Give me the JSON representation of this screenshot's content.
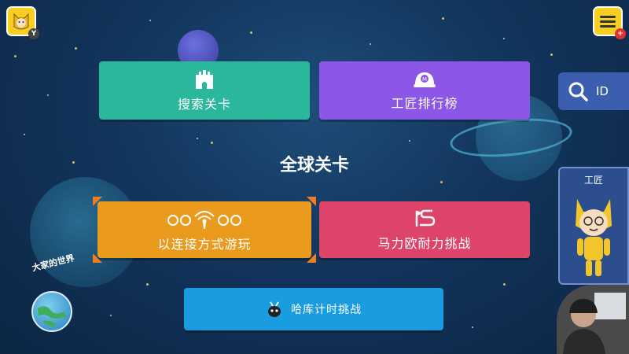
{
  "top_bar": {
    "profile_badge": "Y",
    "menu_badge": "+"
  },
  "buttons": {
    "search_levels": "搜索关卡",
    "maker_ranking": "工匠排行榜",
    "online_play": "以连接方式游玩",
    "endless_challenge": "马力欧耐力挑战",
    "ninji_speedruns": "哈库计时挑战"
  },
  "section_title": "全球关卡",
  "id_search": {
    "label": "ID"
  },
  "maker_card": {
    "title": "工匠"
  },
  "world": {
    "label": "大家的世界"
  },
  "icons": {
    "search_levels": "castle-icon",
    "maker_ranking": "helmet-icon",
    "online_play": "wifi-icon",
    "endless_challenge": "flag-path-icon",
    "ninji_speedruns": "ninji-icon",
    "id_search": "search-icon",
    "menu": "menu-icon"
  },
  "colors": {
    "search_levels": "#2ab79c",
    "maker_ranking": "#8c56e6",
    "online_play": "#ea9a1c",
    "endless_challenge": "#de4469",
    "ninji_speedruns": "#1a9de0",
    "selection": "#f07d22",
    "corner_buttons": "#f6cf22"
  }
}
